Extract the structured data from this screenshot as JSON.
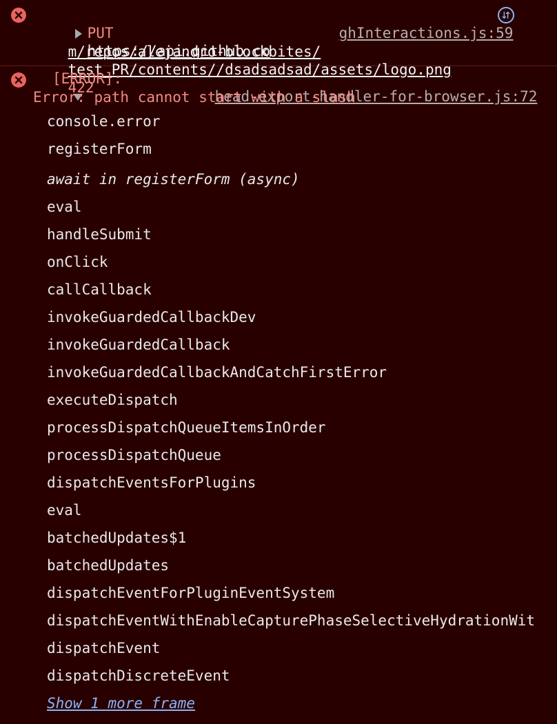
{
  "request_error": {
    "method": "PUT",
    "url_line1": "https://api.github.co",
    "url_line2": "m/repos/alejandro-blockbites/",
    "url_line3": "test_PR/contents//dsadsadsad/assets/logo.png",
    "status": "422",
    "source": "ghInteractions.js:59",
    "network_icon": "network-request-icon"
  },
  "error_message": {
    "tag": "[ERROR]:",
    "source": "head-export-handler-for-browser.js:72",
    "message": "Error: path cannot start with a slash"
  },
  "stack_frames": [
    "console.error",
    "registerForm",
    "await in registerForm (async)",
    "eval",
    "handleSubmit",
    "onClick",
    "callCallback",
    "invokeGuardedCallbackDev",
    "invokeGuardedCallback",
    "invokeGuardedCallbackAndCatchFirstError",
    "executeDispatch",
    "processDispatchQueueItemsInOrder",
    "processDispatchQueue",
    "dispatchEventsForPlugins",
    "eval",
    "batchedUpdates$1",
    "batchedUpdates",
    "dispatchEventForPluginEventSystem",
    "dispatchEventWithEnableCapturePhaseSelectiveHydrationWit",
    "dispatchEvent",
    "dispatchDiscreteEvent"
  ],
  "show_more": "Show 1 more frame",
  "colors": {
    "background": "#290000",
    "error_red": "#f28b82",
    "error_icon": "#e8635f",
    "link_blue": "#8ab4f8"
  }
}
